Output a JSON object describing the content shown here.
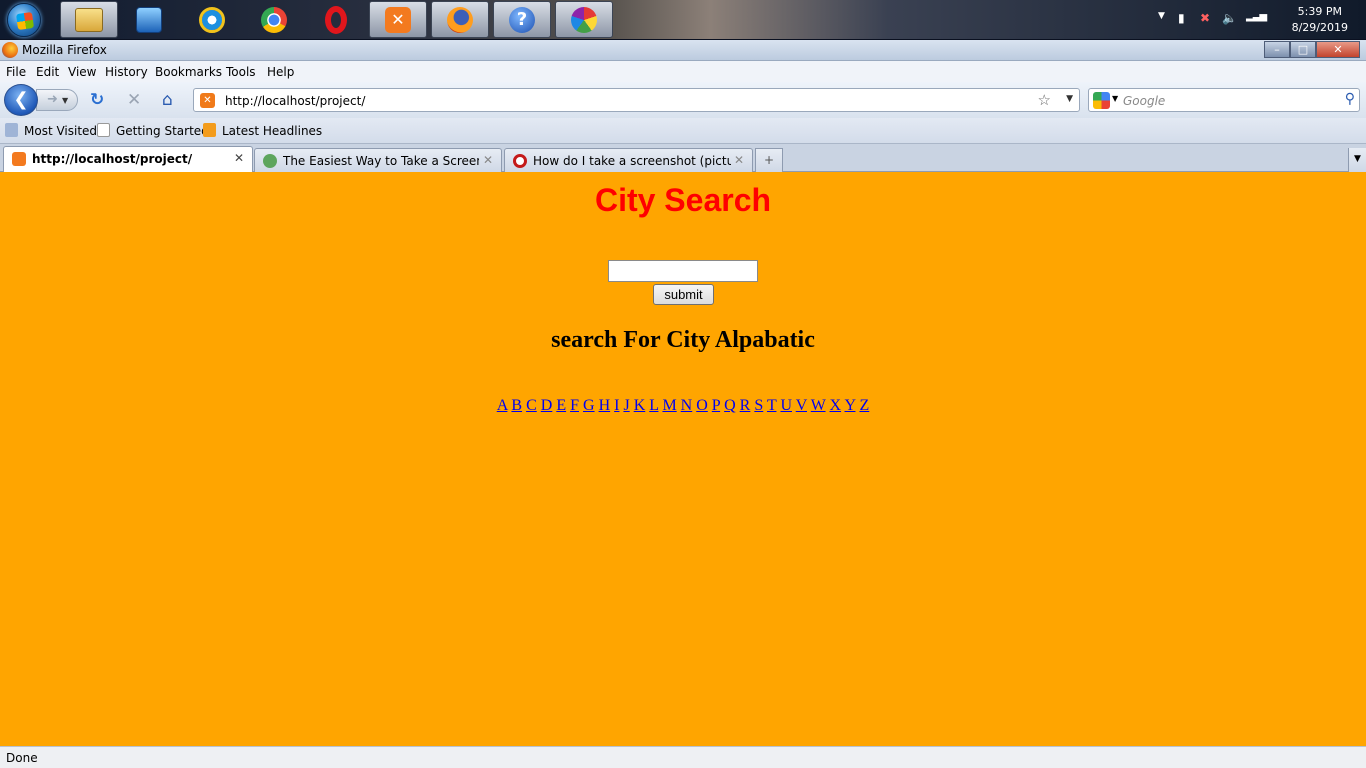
{
  "taskbar": {
    "clock_time": "5:39 PM",
    "clock_date": "8/29/2019",
    "pinned": [
      {
        "icon": "windows-explorer-icon"
      },
      {
        "icon": "media-player-icon"
      },
      {
        "icon": "internet-explorer-icon"
      },
      {
        "icon": "chrome-icon"
      },
      {
        "icon": "opera-icon"
      },
      {
        "icon": "xampp-icon"
      },
      {
        "icon": "firefox-icon"
      },
      {
        "icon": "help-icon"
      },
      {
        "icon": "paint-icon"
      }
    ]
  },
  "window": {
    "title": "Mozilla Firefox",
    "controls": {
      "minimize": "–",
      "maximize": "□",
      "close": "✕"
    }
  },
  "menu": {
    "items": [
      "File",
      "Edit",
      "View",
      "History",
      "Bookmarks",
      "Tools",
      "Help"
    ]
  },
  "navbar": {
    "url": "http://localhost/project/",
    "search_placeholder": "Google"
  },
  "bookmarks": {
    "items": [
      "Most Visited",
      "Getting Started",
      "Latest Headlines"
    ]
  },
  "tabs": [
    {
      "label": "http://localhost/project/",
      "selected": true
    },
    {
      "label": "The Easiest Way to Take a Screensh...",
      "selected": false
    },
    {
      "label": "How do I take a screenshot (picture ...",
      "selected": false
    }
  ],
  "page": {
    "title": "City Search",
    "input_value": "",
    "submit_label": "submit",
    "subtitle": "search For City Alpabatic",
    "letters": [
      "A",
      "B",
      "C",
      "D",
      "E",
      "F",
      "G",
      "H",
      "I",
      "J",
      "K",
      "L",
      "M",
      "N",
      "O",
      "P",
      "Q",
      "R",
      "S",
      "T",
      "U",
      "V",
      "W",
      "X",
      "Y",
      "Z"
    ],
    "background_color": "#ffa500",
    "title_color": "#ff0000",
    "link_color": "#0000ee"
  },
  "status": {
    "text": "Done"
  }
}
